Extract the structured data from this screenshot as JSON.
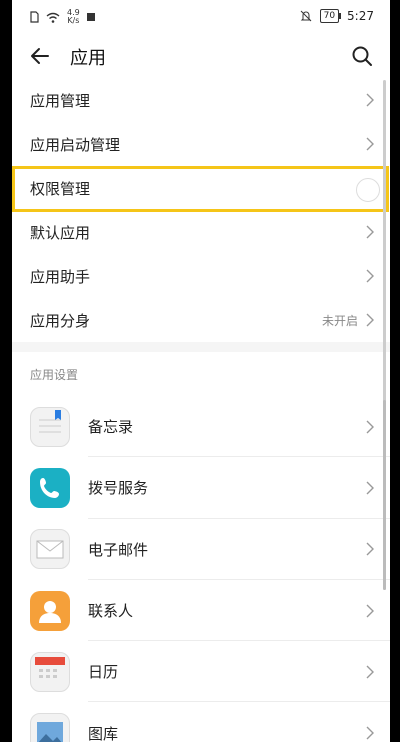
{
  "status_bar": {
    "speed_value": "4.9",
    "speed_unit": "K/s",
    "battery": "70",
    "time": "5:27"
  },
  "header": {
    "title": "应用"
  },
  "settings_items": [
    {
      "label": "应用管理",
      "status": ""
    },
    {
      "label": "应用启动管理",
      "status": ""
    },
    {
      "label": "权限管理",
      "status": ""
    },
    {
      "label": "默认应用",
      "status": ""
    },
    {
      "label": "应用助手",
      "status": ""
    },
    {
      "label": "应用分身",
      "status": "未开启"
    }
  ],
  "section_title": "应用设置",
  "apps": [
    {
      "label": "备忘录",
      "icon": "notes-icon",
      "color": "#f2f2f2"
    },
    {
      "label": "拨号服务",
      "icon": "phone-icon",
      "color": "#1bb0c4"
    },
    {
      "label": "电子邮件",
      "icon": "mail-icon",
      "color": "#f2f2f2"
    },
    {
      "label": "联系人",
      "icon": "contacts-icon",
      "color": "#f5a03a"
    },
    {
      "label": "日历",
      "icon": "calendar-icon",
      "color": "#f2f2f2"
    },
    {
      "label": "图库",
      "icon": "gallery-icon",
      "color": "#f2f2f2"
    }
  ],
  "colors": {
    "highlight": "#f5c518",
    "background": "#f5f5f5"
  }
}
